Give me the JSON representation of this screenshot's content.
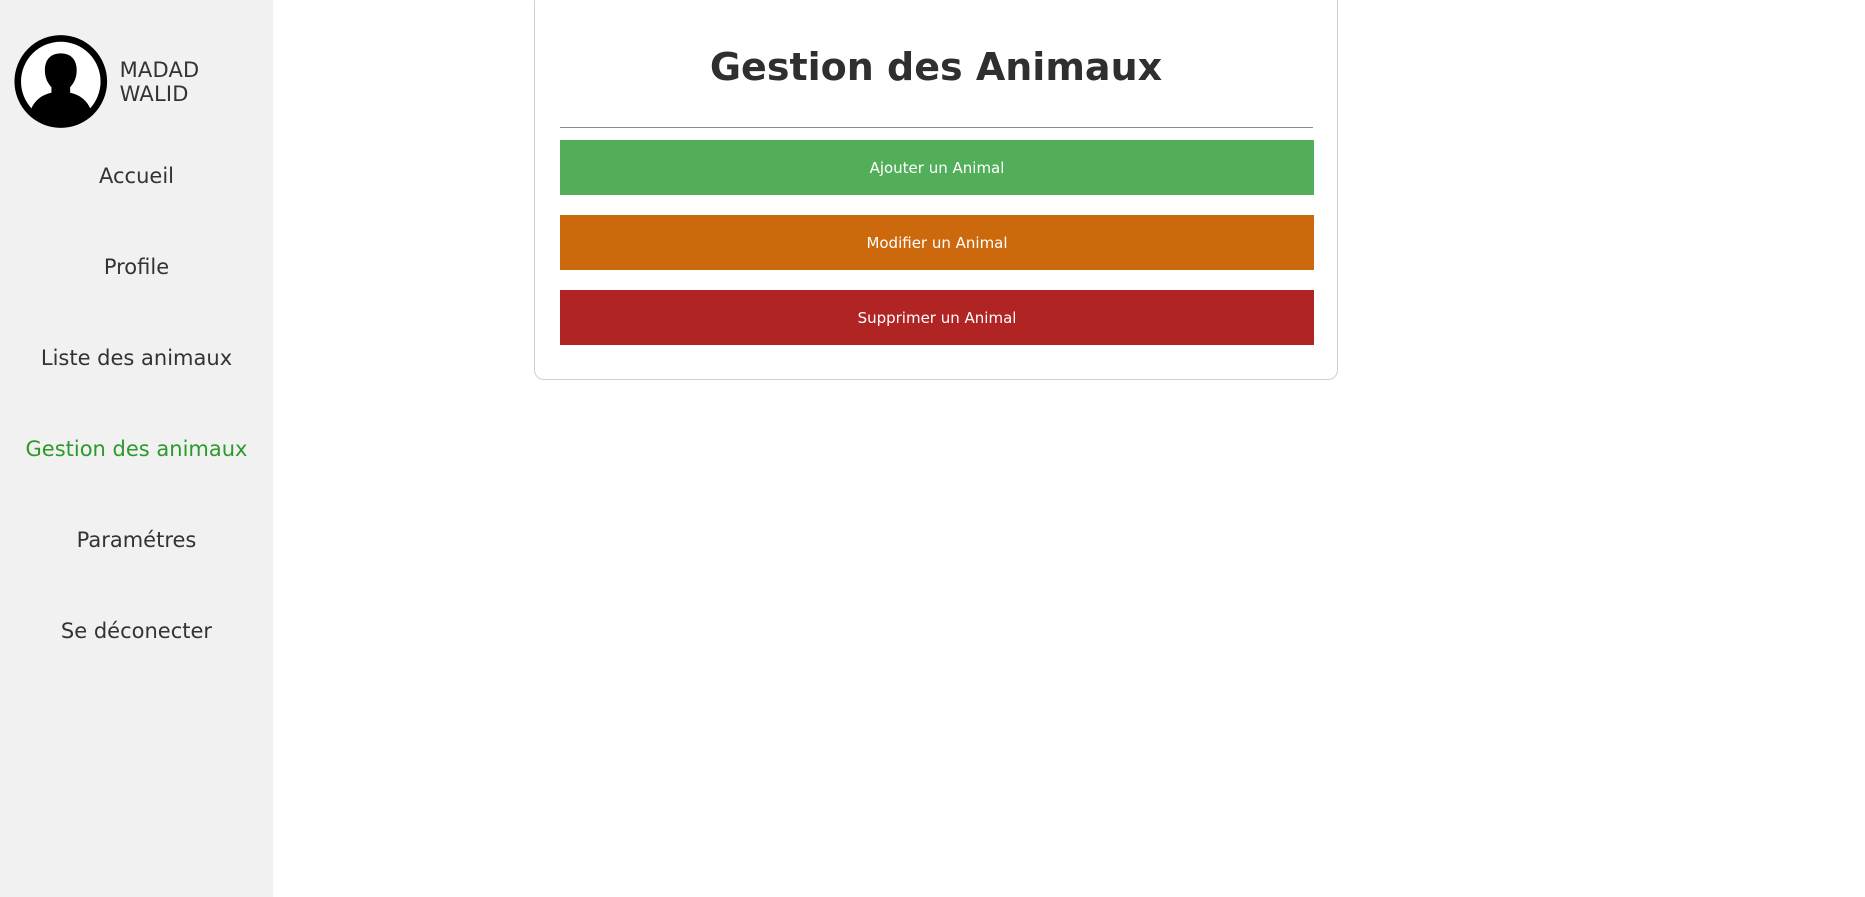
{
  "user": {
    "name": "MADAD WALID",
    "avatar_icon": "user-silhouette-icon"
  },
  "nav": {
    "items": [
      {
        "label": "Accueil",
        "active": false
      },
      {
        "label": "Profile",
        "active": false
      },
      {
        "label": "Liste des animaux",
        "active": false
      },
      {
        "label": "Gestion des animaux",
        "active": true
      },
      {
        "label": "Paramétres",
        "active": false
      },
      {
        "label": "Se déconecter",
        "active": false
      }
    ]
  },
  "main": {
    "title": "Gestion des Animaux",
    "actions": [
      {
        "label": "Ajouter un Animal",
        "color": "#52ae58"
      },
      {
        "label": "Modifier un Animal",
        "color": "#cc690d"
      },
      {
        "label": "Supprimer un Animal",
        "color": "#b12424"
      }
    ]
  },
  "colors": {
    "sidebar_bg": "#f1f1f1",
    "active_nav": "#2b9a2b",
    "text": "#333333"
  }
}
